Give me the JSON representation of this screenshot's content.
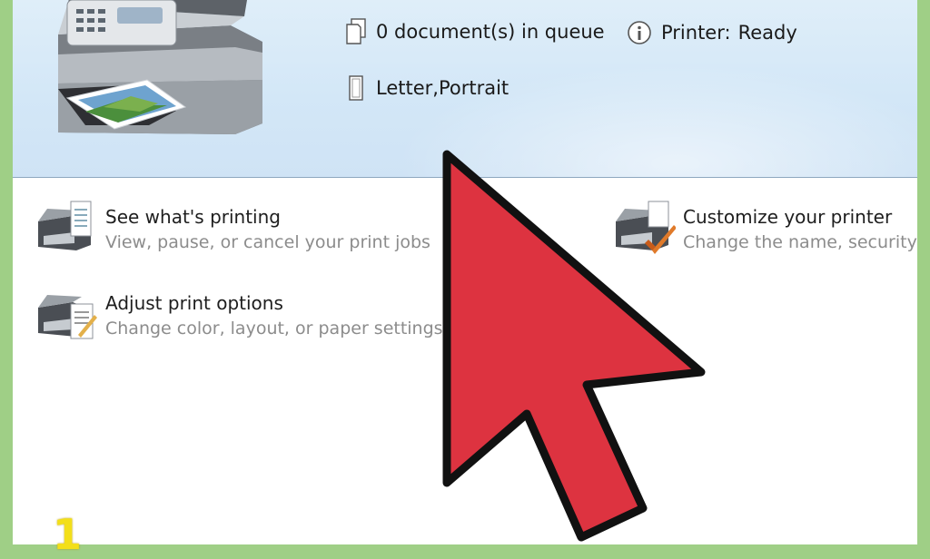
{
  "header": {
    "queue_text": "0 document(s) in queue",
    "status_label": "Printer:",
    "status_value": "Ready",
    "paper_text": "Letter,Portrait"
  },
  "tasks": [
    {
      "title": "See what's printing",
      "desc": "View, pause, or cancel your print jobs"
    },
    {
      "title": "Adjust print options",
      "desc": "Change color, layout, or paper settings"
    },
    {
      "title": "Customize your printer",
      "desc": "Change the name, security s"
    }
  ],
  "step_number": "1",
  "colors": {
    "cursor": "#dd3340",
    "background": "#9fcf86",
    "step_number": "#f3df19"
  },
  "icons": [
    "document-queue-icon",
    "info-icon",
    "paper-icon",
    "printer-queue-icon",
    "printer-options-icon",
    "printer-customize-icon",
    "mouse-pointer-icon"
  ]
}
